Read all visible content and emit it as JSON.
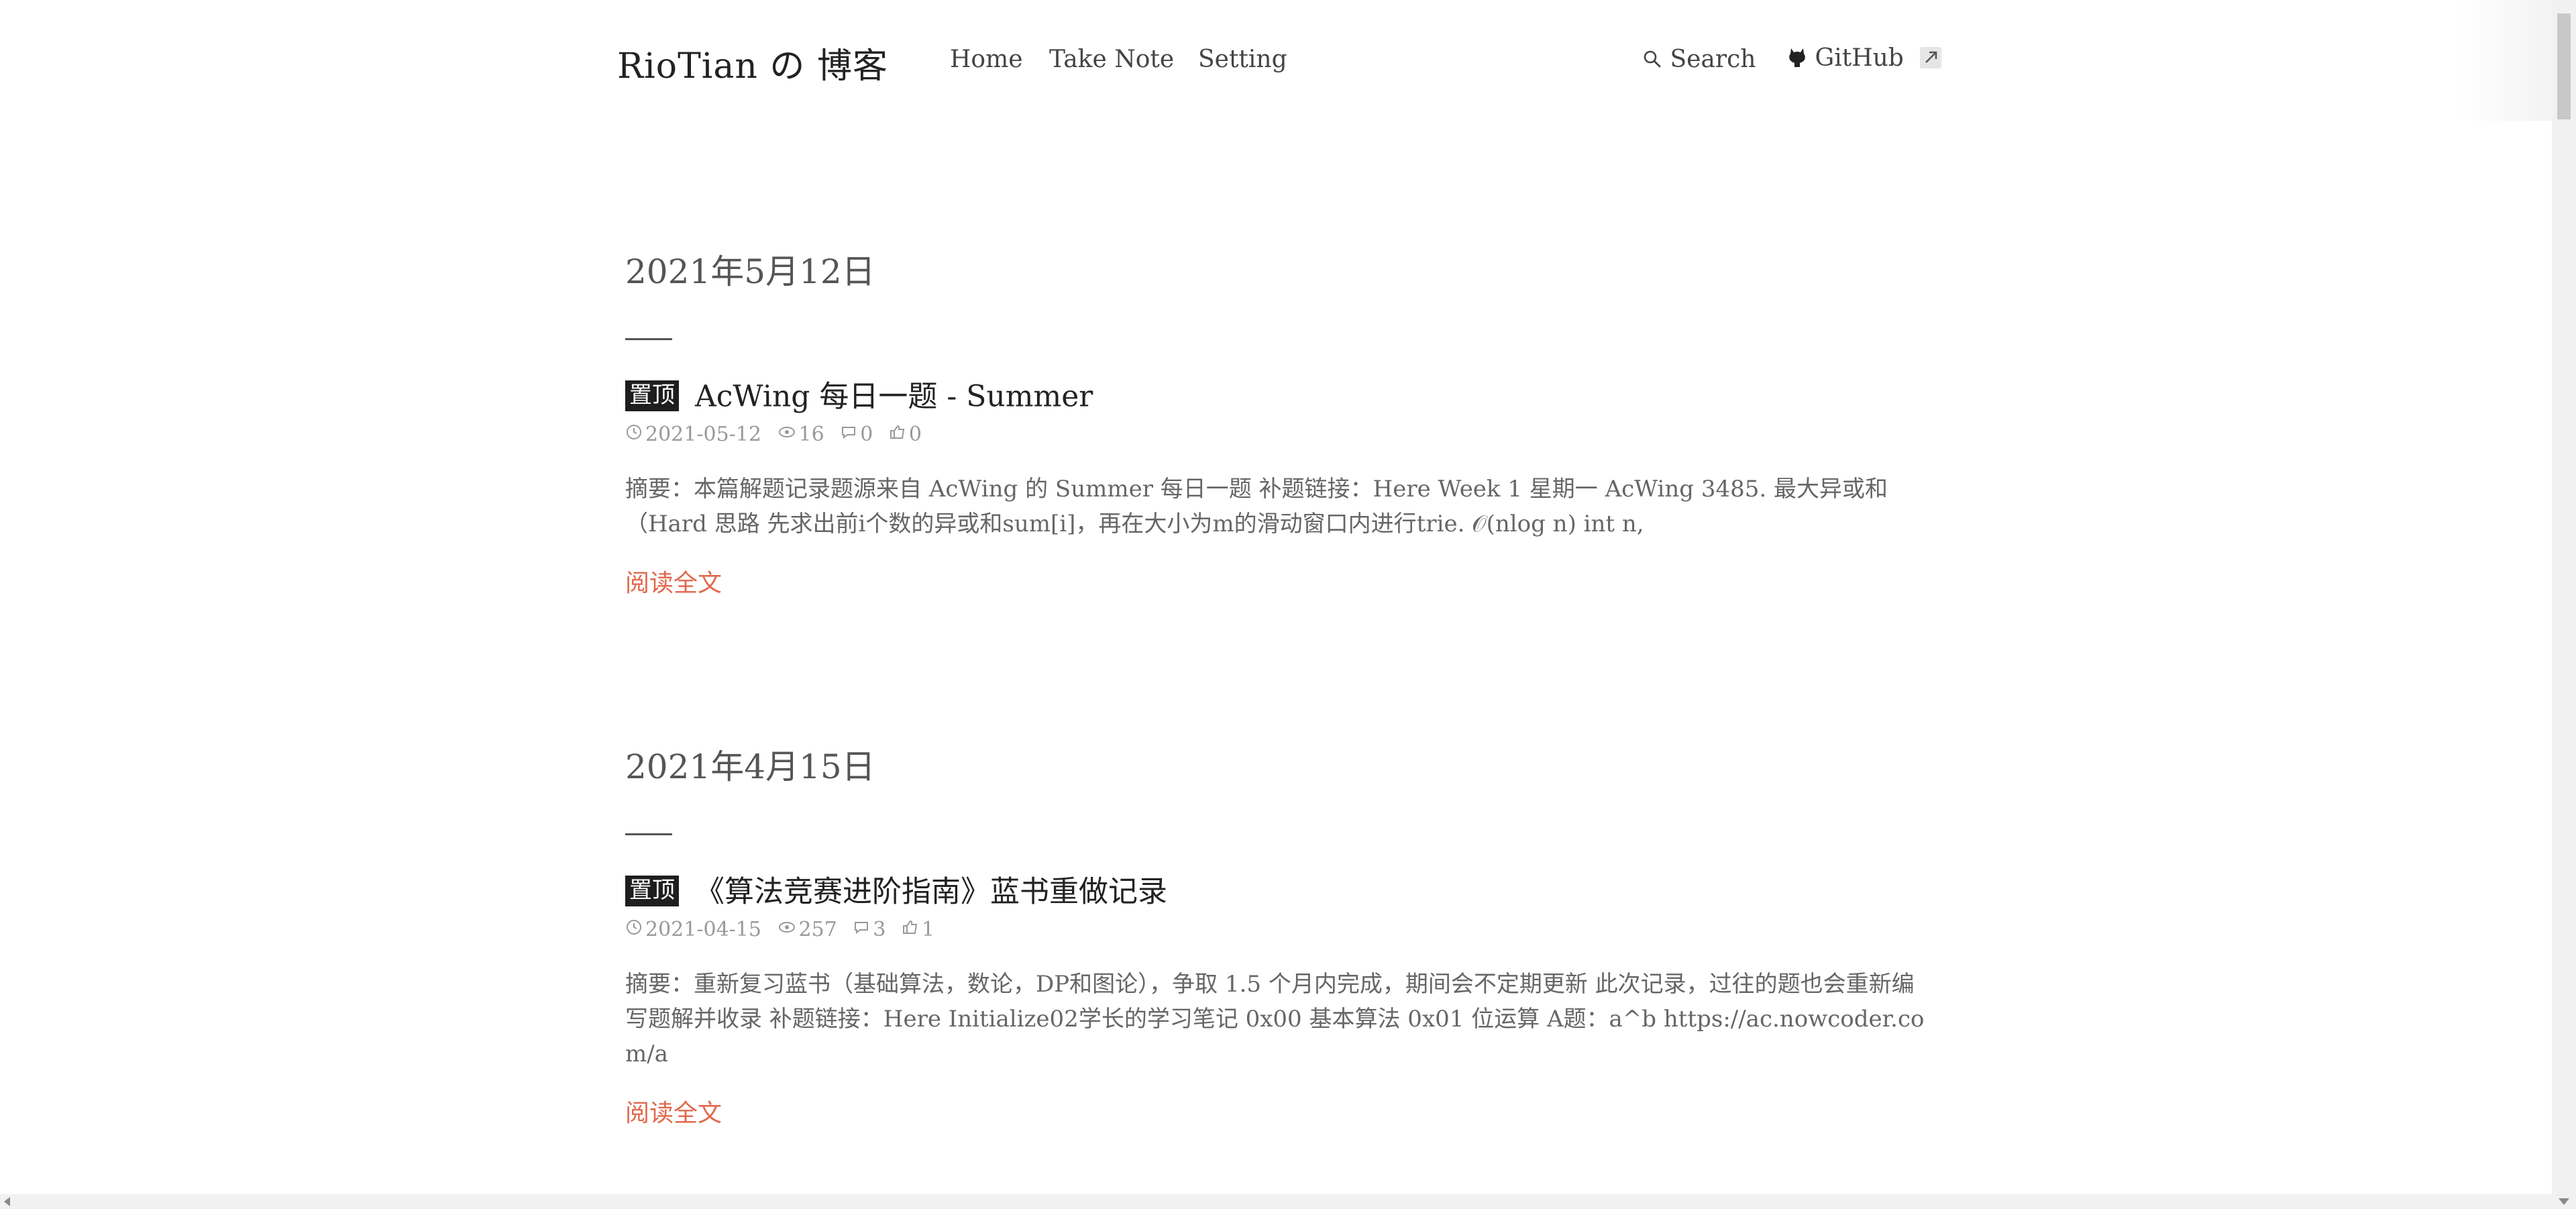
{
  "header": {
    "brand": "RioTian の 博客",
    "nav": [
      "Home",
      "Take Note",
      "Setting"
    ],
    "search_label": "Search",
    "github_label": "GitHub"
  },
  "posts": [
    {
      "date_heading": "2021年5月12日",
      "pin_label": "置顶",
      "title": "AcWing 每日一题 - Summer",
      "date": "2021-05-12",
      "views": "16",
      "comments": "0",
      "likes": "0",
      "summary": "摘要：本篇解题记录题源来自 AcWing 的 Summer 每日一题 补题链接：Here Week 1 星期一 AcWing 3485. 最大异或和（Hard 思路 先求出前i个数的异或和sum[i]，再在大小为m的滑动窗口内进行trie. 𝒪(nlog n) int n,",
      "read_more": "阅读全文"
    },
    {
      "date_heading": "2021年4月15日",
      "pin_label": "置顶",
      "title": "《算法竞赛进阶指南》蓝书重做记录",
      "date": "2021-04-15",
      "views": "257",
      "comments": "3",
      "likes": "1",
      "summary": "摘要：重新复习蓝书（基础算法，数论，DP和图论），争取 1.5 个月内完成，期间会不定期更新 此次记录，过往的题也会重新编写题解并收录 补题链接：Here Initialize02学长的学习笔记 0x00 基本算法 0x01 位运算 A题：a^b https://ac.nowcoder.com/a",
      "read_more": "阅读全文"
    }
  ],
  "colors": {
    "accent_link": "#e0694d",
    "pin_badge_bg": "#1e1e1e",
    "meta_text": "#999999"
  }
}
